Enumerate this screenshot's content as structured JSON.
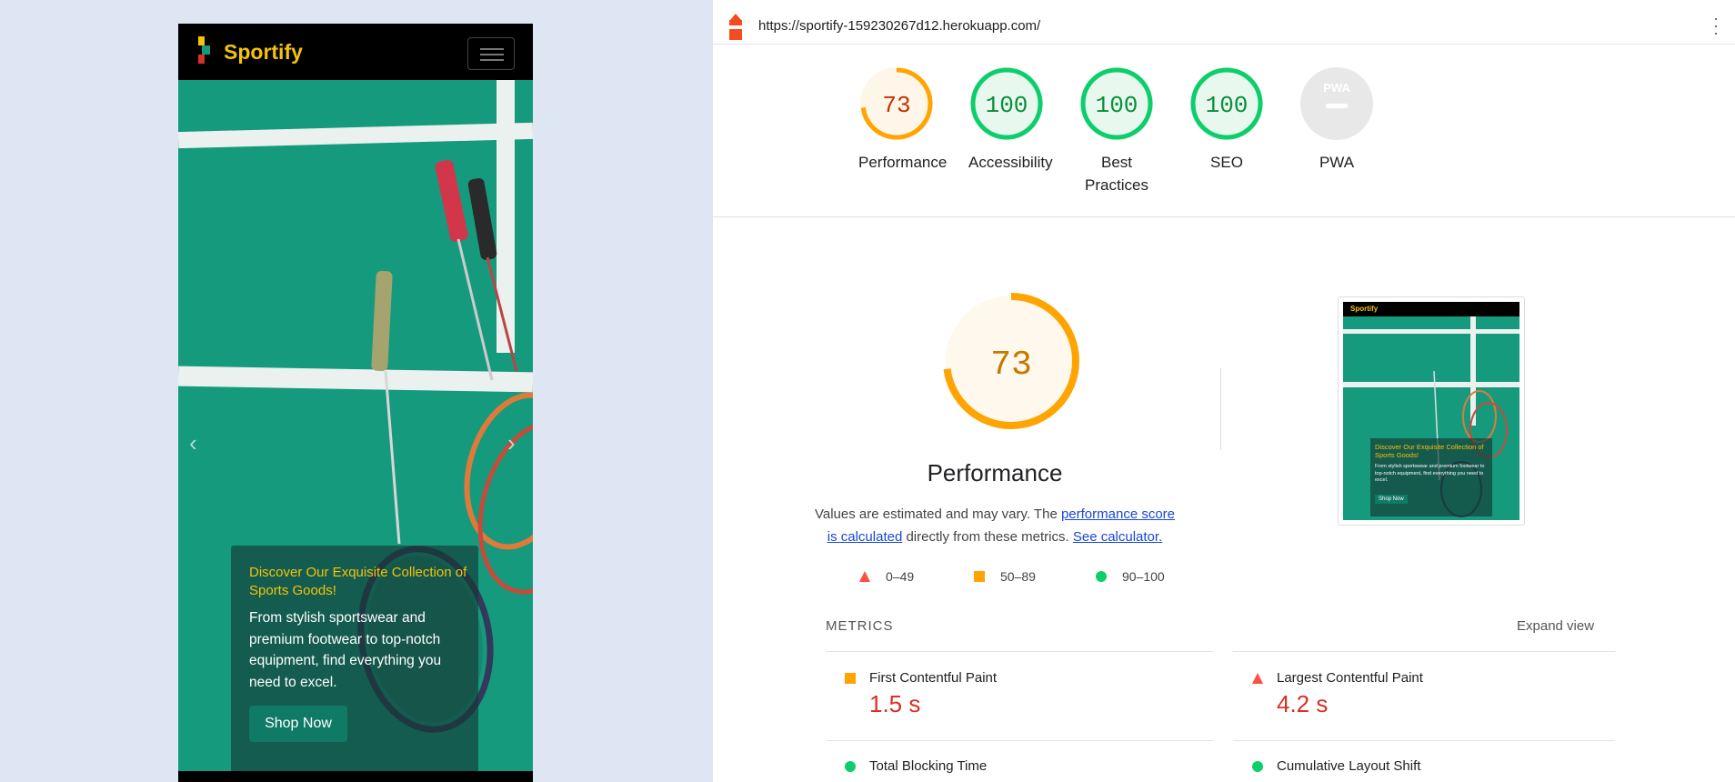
{
  "mobile": {
    "brand": "Sportify",
    "caption_title": "Discover Our Exquisite Collection of Sports Goods!",
    "caption_text": "From stylish sportswear and premium footwear to top-notch equipment, find everything you need to excel.",
    "cta_label": "Shop Now",
    "prev_glyph": "‹",
    "next_glyph": "›"
  },
  "report": {
    "url": "https://sportify-159230267d12.herokuapp.com/",
    "gauges": [
      {
        "label": "Performance",
        "score": "73",
        "value": 0.73,
        "color": "#ffa400"
      },
      {
        "label": "Accessibility",
        "score": "100",
        "value": 1.0,
        "color": "#0cce6b"
      },
      {
        "label": "Best Practices",
        "score": "100",
        "value": 1.0,
        "color": "#0cce6b"
      },
      {
        "label": "SEO",
        "score": "100",
        "value": 1.0,
        "color": "#0cce6b"
      },
      {
        "label": "PWA",
        "score": "PWA",
        "value": 0,
        "color": "#cccccc"
      }
    ],
    "main_score": "73",
    "main_title": "Performance",
    "desc_prefix": "Values are estimated and may vary. The ",
    "desc_link1": "performance score is calculated",
    "desc_middle": " directly from these metrics. ",
    "desc_link2": "See calculator.",
    "legend": [
      {
        "range": "0–49",
        "shape": "triangle",
        "color": "#ff4e42"
      },
      {
        "range": "50–89",
        "shape": "square",
        "color": "#ffa400"
      },
      {
        "range": "90–100",
        "shape": "circle",
        "color": "#0cce6b"
      }
    ],
    "metrics_heading": "METRICS",
    "expand_label": "Expand view",
    "metrics": [
      {
        "label": "First Contentful Paint",
        "value": "1.5 s",
        "status": "square",
        "color": "#ffa400"
      },
      {
        "label": "Largest Contentful Paint",
        "value": "4.2 s",
        "status": "triangle",
        "color": "#ff4e42"
      },
      {
        "label": "Total Blocking Time",
        "value": "",
        "status": "circle",
        "color": "#0cce6b"
      },
      {
        "label": "Cumulative Layout Shift",
        "value": "",
        "status": "circle",
        "color": "#0cce6b"
      }
    ],
    "thumb": {
      "brand": "Sportify",
      "title": "Discover Our Exquisite Collection of Sports Goods!",
      "text": "From stylish sportswear and premium footwear to top-notch equipment, find everything you need to excel.",
      "cta": "Shop Now"
    }
  }
}
